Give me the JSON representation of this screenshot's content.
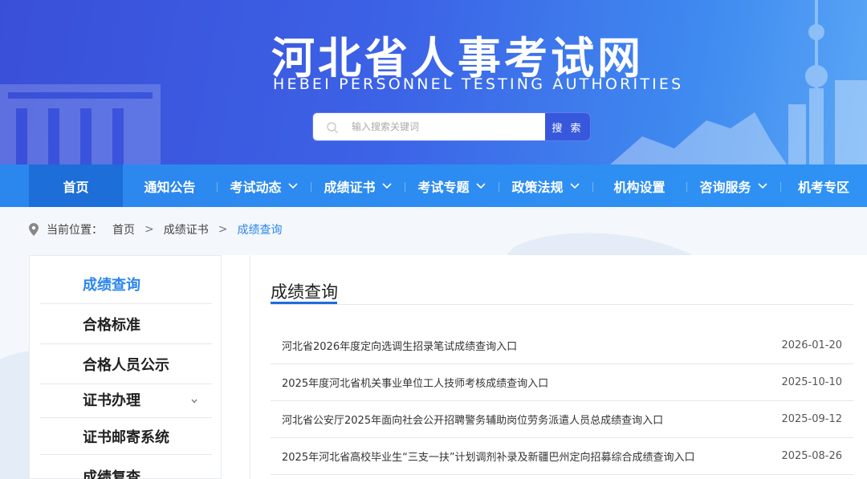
{
  "header": {
    "title": "河北省人事考试网",
    "subtitle": "HEBEI PERSONNEL TESTING AUTHORITIES"
  },
  "search": {
    "placeholder": "输入搜索关键词",
    "button_label": "搜 索"
  },
  "nav": {
    "items": [
      {
        "label": "首页",
        "dropdown": false,
        "active": true
      },
      {
        "label": "通知公告",
        "dropdown": false
      },
      {
        "label": "考试动态",
        "dropdown": true
      },
      {
        "label": "成绩证书",
        "dropdown": true
      },
      {
        "label": "考试专题",
        "dropdown": true
      },
      {
        "label": "政策法规",
        "dropdown": true
      },
      {
        "label": "机构设置",
        "dropdown": false
      },
      {
        "label": "咨询服务",
        "dropdown": true
      },
      {
        "label": "机考专区",
        "dropdown": false
      }
    ]
  },
  "breadcrumb": {
    "prefix": "当前位置：",
    "items": [
      "首页",
      "成绩证书",
      "成绩查询"
    ]
  },
  "sidebar": {
    "items": [
      {
        "label": "成绩查询",
        "active": true
      },
      {
        "label": "合格标准"
      },
      {
        "label": "合格人员公示"
      },
      {
        "label": "证书办理",
        "dropdown": true
      },
      {
        "label": "证书邮寄系统"
      },
      {
        "label": "成绩复查"
      }
    ]
  },
  "main": {
    "title": "成绩查询",
    "rows": [
      {
        "title": "河北省2026年度定向选调生招录笔试成绩查询入口",
        "date": "2026-01-20"
      },
      {
        "title": "2025年度河北省机关事业单位工人技师考核成绩查询入口",
        "date": "2025-10-10"
      },
      {
        "title": "河北省公安厅2025年面向社会公开招聘警务辅助岗位劳务派遣人员总成绩查询入口",
        "date": "2025-09-12"
      },
      {
        "title": "2025年河北省高校毕业生“三支一扶”计划调剂补录及新疆巴州定向招募综合成绩查询入口",
        "date": "2025-08-26"
      }
    ]
  },
  "colors": {
    "header_gradient_start": "#3a4fd8",
    "header_gradient_end": "#5aa6f5",
    "nav_bg": "#2b86ee",
    "nav_active": "#1d6ed8",
    "accent": "#2b86ee"
  }
}
